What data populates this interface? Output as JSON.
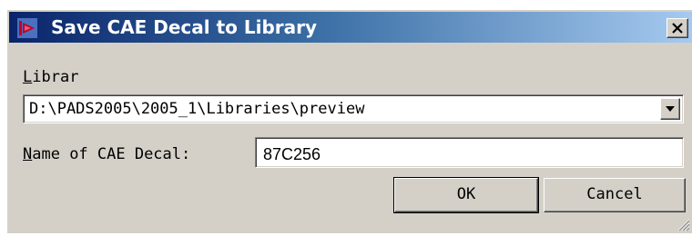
{
  "window": {
    "title": "Save CAE Decal to Library",
    "icon": "pads-app-icon",
    "close_icon": "close-icon"
  },
  "library": {
    "label_mnemonic": "L",
    "label_rest": "ibrar",
    "selected_value": "D:\\PADS2005\\2005_1\\Libraries\\preview",
    "dropdown_icon": "chevron-down-icon"
  },
  "decal_name": {
    "label_mnemonic": "N",
    "label_rest": "ame of CAE Decal:",
    "value": "87C256"
  },
  "buttons": {
    "ok_label": "OK",
    "cancel_label": "Cancel"
  },
  "colors": {
    "title_gradient_start": "#0a246a",
    "title_gradient_end": "#a6caf0",
    "face": "#d4d0c8",
    "icon_red": "#c0002a"
  }
}
